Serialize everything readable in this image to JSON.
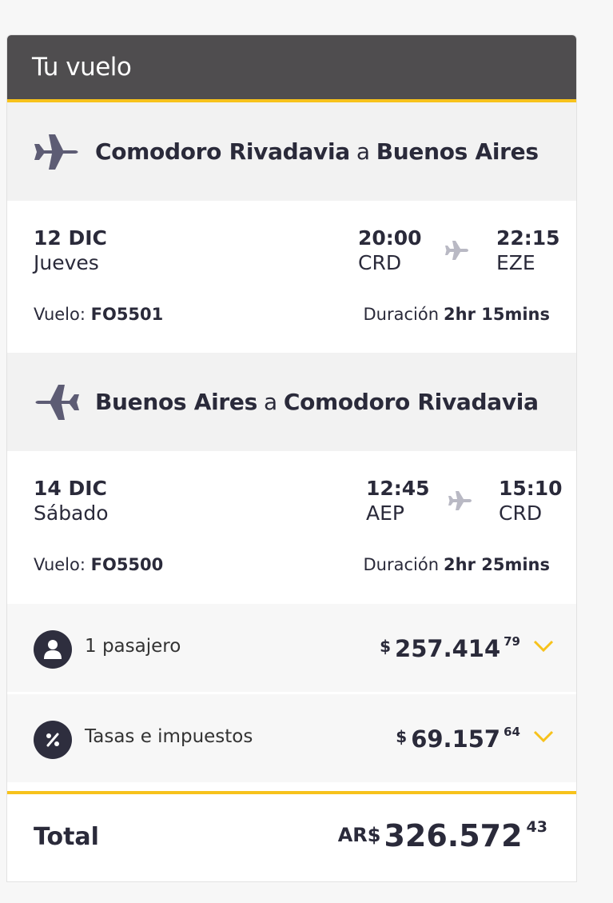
{
  "header": {
    "title": "Tu vuelo"
  },
  "outbound": {
    "origin": "Comodoro Rivadavia",
    "connector": "a",
    "destination": "Buenos Aires",
    "date": "12 DIC",
    "weekday": "Jueves",
    "depart_time": "20:00",
    "depart_airport": "CRD",
    "arrive_time": "22:15",
    "arrive_airport": "EZE",
    "flight_label": "Vuelo:",
    "flight_number": "FO5501",
    "duration_label": "Duración",
    "duration": "2hr 15mins"
  },
  "inbound": {
    "origin": "Buenos Aires",
    "connector": "a",
    "destination": "Comodoro Rivadavia",
    "date": "14 DIC",
    "weekday": "Sábado",
    "depart_time": "12:45",
    "depart_airport": "AEP",
    "arrive_time": "15:10",
    "arrive_airport": "CRD",
    "flight_label": "Vuelo:",
    "flight_number": "FO5500",
    "duration_label": "Duración",
    "duration": "2hr 25mins"
  },
  "passengers": {
    "label": "1 pasajero",
    "currency": "$",
    "amount": "257.414",
    "cents": "79",
    "icon": "person-icon"
  },
  "taxes": {
    "label": "Tasas e impuestos",
    "currency": "$",
    "amount": "69.157",
    "cents": "64",
    "icon": "percent-icon"
  },
  "total": {
    "label": "Total",
    "currency": "AR$",
    "amount": "326.572",
    "cents": "43"
  },
  "colors": {
    "header_bg": "#4f4d4f",
    "accent": "#f7c21b",
    "text_dark": "#2a2a3a",
    "icon_plane": "#5d5c74"
  }
}
